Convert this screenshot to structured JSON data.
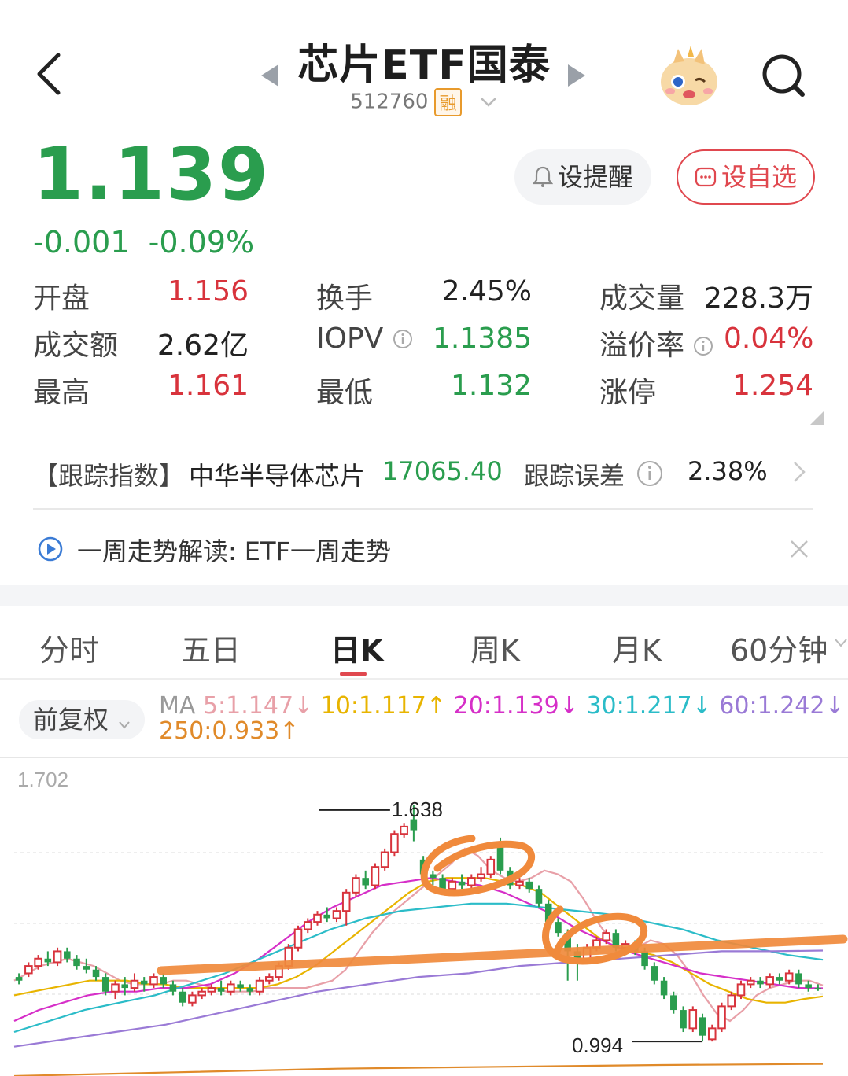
{
  "header": {
    "title": "芯片ETF国泰",
    "code": "512760",
    "badge": "融",
    "icons": {
      "back": "back-arrow-icon",
      "prev": "prev-triangle-icon",
      "next": "next-triangle-icon",
      "dropdown": "chevron-down-icon",
      "mascot": "mascot-avatar",
      "search": "search-icon"
    }
  },
  "quote": {
    "price": "1.139",
    "change": "-0.001",
    "change_pct": "-0.09%",
    "color_down": "#2a9d4e",
    "color_up": "#d8333c"
  },
  "actions": {
    "alert_label": "设提醒",
    "fav_label": "设自选"
  },
  "stats": {
    "open_label": "开盘",
    "open": "1.156",
    "turnover_label": "换手",
    "turnover": "2.45%",
    "volume_label": "成交量",
    "volume": "228.3万",
    "amount_label": "成交额",
    "amount": "2.62亿",
    "iopv_label": "IOPV",
    "iopv": "1.1385",
    "premium_label": "溢价率",
    "premium": "0.04%",
    "high_label": "最高",
    "high": "1.161",
    "low_label": "最低",
    "low": "1.132",
    "limit_label": "涨停",
    "limit": "1.254"
  },
  "tracking": {
    "tag": "【跟踪指数】",
    "index_name": "中华半导体芯片",
    "index_value": "17065.40",
    "error_label": "跟踪误差",
    "error_value": "2.38%"
  },
  "weekly": {
    "label": "一周走势解读:",
    "text": "ETF一周走势"
  },
  "tabs": [
    "分时",
    "五日",
    "日K",
    "周K",
    "月K",
    "60分钟"
  ],
  "chart_controls": {
    "adjust": "前复权",
    "ma_prefix": "MA",
    "ma5": "5:1.147↓",
    "ma10": "10:1.117↑",
    "ma20": "20:1.139↓",
    "ma30": "30:1.217↓",
    "ma60": "60:1.242↓",
    "ma250": "250:0.933↑",
    "colors": {
      "ma5": "#e8a0a8",
      "ma10": "#e8b400",
      "ma20": "#d62fc8",
      "ma30": "#2bbcc8",
      "ma60": "#9a7ad6",
      "ma250": "#e08a2a"
    }
  },
  "chart_data": {
    "type": "candlestick",
    "y_top_label": "1.702",
    "ylim": [
      0.93,
      1.702
    ],
    "annotations": {
      "high": "1.638",
      "low": "0.994"
    },
    "candles": [
      [
        1.17,
        1.16,
        1.18,
        1.15
      ],
      [
        1.18,
        1.2,
        1.21,
        1.17
      ],
      [
        1.2,
        1.22,
        1.23,
        1.19
      ],
      [
        1.22,
        1.21,
        1.24,
        1.2
      ],
      [
        1.21,
        1.24,
        1.25,
        1.2
      ],
      [
        1.24,
        1.22,
        1.25,
        1.21
      ],
      [
        1.22,
        1.2,
        1.23,
        1.19
      ],
      [
        1.2,
        1.19,
        1.22,
        1.18
      ],
      [
        1.19,
        1.17,
        1.2,
        1.16
      ],
      [
        1.17,
        1.13,
        1.18,
        1.12
      ],
      [
        1.13,
        1.15,
        1.16,
        1.11
      ],
      [
        1.15,
        1.14,
        1.17,
        1.12
      ],
      [
        1.14,
        1.16,
        1.18,
        1.13
      ],
      [
        1.16,
        1.15,
        1.17,
        1.13
      ],
      [
        1.15,
        1.17,
        1.18,
        1.14
      ],
      [
        1.17,
        1.15,
        1.18,
        1.14
      ],
      [
        1.15,
        1.13,
        1.16,
        1.12
      ],
      [
        1.13,
        1.1,
        1.14,
        1.09
      ],
      [
        1.1,
        1.12,
        1.13,
        1.09
      ],
      [
        1.12,
        1.13,
        1.14,
        1.11
      ],
      [
        1.13,
        1.14,
        1.15,
        1.12
      ],
      [
        1.14,
        1.13,
        1.16,
        1.12
      ],
      [
        1.13,
        1.15,
        1.16,
        1.12
      ],
      [
        1.15,
        1.14,
        1.16,
        1.13
      ],
      [
        1.14,
        1.13,
        1.15,
        1.12
      ],
      [
        1.13,
        1.16,
        1.17,
        1.12
      ],
      [
        1.16,
        1.17,
        1.18,
        1.15
      ],
      [
        1.17,
        1.2,
        1.21,
        1.16
      ],
      [
        1.2,
        1.25,
        1.26,
        1.19
      ],
      [
        1.25,
        1.3,
        1.31,
        1.24
      ],
      [
        1.3,
        1.32,
        1.33,
        1.29
      ],
      [
        1.32,
        1.34,
        1.35,
        1.31
      ],
      [
        1.34,
        1.33,
        1.36,
        1.32
      ],
      [
        1.33,
        1.35,
        1.36,
        1.32
      ],
      [
        1.35,
        1.4,
        1.41,
        1.31
      ],
      [
        1.4,
        1.44,
        1.45,
        1.39
      ],
      [
        1.44,
        1.42,
        1.46,
        1.41
      ],
      [
        1.42,
        1.47,
        1.48,
        1.41
      ],
      [
        1.47,
        1.51,
        1.52,
        1.46
      ],
      [
        1.51,
        1.56,
        1.57,
        1.5
      ],
      [
        1.56,
        1.58,
        1.59,
        1.55
      ],
      [
        1.6,
        1.57,
        1.638,
        1.54
      ],
      [
        1.49,
        1.45,
        1.5,
        1.44
      ],
      [
        1.45,
        1.44,
        1.46,
        1.42
      ],
      [
        1.44,
        1.41,
        1.45,
        1.4
      ],
      [
        1.41,
        1.43,
        1.44,
        1.4
      ],
      [
        1.43,
        1.42,
        1.45,
        1.41
      ],
      [
        1.42,
        1.44,
        1.45,
        1.41
      ],
      [
        1.44,
        1.45,
        1.47,
        1.43
      ],
      [
        1.45,
        1.49,
        1.5,
        1.44
      ],
      [
        1.54,
        1.46,
        1.55,
        1.45
      ],
      [
        1.46,
        1.42,
        1.47,
        1.41
      ],
      [
        1.42,
        1.43,
        1.44,
        1.41
      ],
      [
        1.43,
        1.41,
        1.44,
        1.4
      ],
      [
        1.41,
        1.37,
        1.42,
        1.36
      ],
      [
        1.37,
        1.32,
        1.38,
        1.31
      ],
      [
        1.32,
        1.29,
        1.33,
        1.28
      ],
      [
        1.29,
        1.24,
        1.3,
        1.16
      ],
      [
        1.24,
        1.22,
        1.26,
        1.16
      ],
      [
        1.22,
        1.25,
        1.26,
        1.21
      ],
      [
        1.25,
        1.27,
        1.28,
        1.24
      ],
      [
        1.27,
        1.29,
        1.3,
        1.26
      ],
      [
        1.29,
        1.25,
        1.3,
        1.24
      ],
      [
        1.25,
        1.26,
        1.27,
        1.24
      ],
      [
        1.26,
        1.24,
        1.27,
        1.23
      ],
      [
        1.24,
        1.2,
        1.25,
        1.19
      ],
      [
        1.2,
        1.16,
        1.21,
        1.15
      ],
      [
        1.16,
        1.12,
        1.17,
        1.11
      ],
      [
        1.12,
        1.08,
        1.13,
        1.07
      ],
      [
        1.08,
        1.03,
        1.09,
        1.02
      ],
      [
        1.03,
        1.08,
        1.09,
        1.02
      ],
      [
        1.06,
        1.01,
        1.07,
        0.994
      ],
      [
        1.0,
        1.03,
        1.04,
        0.994
      ],
      [
        1.03,
        1.09,
        1.1,
        1.02
      ],
      [
        1.09,
        1.12,
        1.13,
        1.08
      ],
      [
        1.12,
        1.15,
        1.16,
        1.11
      ],
      [
        1.15,
        1.16,
        1.17,
        1.14
      ],
      [
        1.16,
        1.15,
        1.17,
        1.14
      ],
      [
        1.15,
        1.17,
        1.18,
        1.14
      ],
      [
        1.17,
        1.16,
        1.18,
        1.15
      ],
      [
        1.16,
        1.18,
        1.19,
        1.15
      ],
      [
        1.18,
        1.15,
        1.19,
        1.14
      ],
      [
        1.15,
        1.14,
        1.16,
        1.13
      ],
      [
        1.14,
        1.139,
        1.15,
        1.132
      ]
    ],
    "series": [
      {
        "values": [
          1.16,
          1.18,
          1.2,
          1.21,
          1.22,
          1.21,
          1.2,
          1.18,
          1.16,
          1.15,
          1.15,
          1.15,
          1.16,
          1.16,
          1.15,
          1.14,
          1.13,
          1.13,
          1.13,
          1.14,
          1.14,
          1.14,
          1.14,
          1.15,
          1.16,
          1.19,
          1.24,
          1.29,
          1.33,
          1.36,
          1.39,
          1.42,
          1.45,
          1.48,
          1.52,
          1.5,
          1.46,
          1.44,
          1.43,
          1.44,
          1.46,
          1.45,
          1.43,
          1.38,
          1.32,
          1.27,
          1.24,
          1.25,
          1.27,
          1.26,
          1.23,
          1.18,
          1.12,
          1.07,
          1.05,
          1.08,
          1.12,
          1.14,
          1.15,
          1.16,
          1.16,
          1.147
        ]
      },
      {
        "values": [
          1.12,
          1.13,
          1.14,
          1.15,
          1.16,
          1.16,
          1.16,
          1.15,
          1.15,
          1.14,
          1.14,
          1.14,
          1.14,
          1.14,
          1.15,
          1.17,
          1.2,
          1.24,
          1.28,
          1.32,
          1.36,
          1.4,
          1.43,
          1.44,
          1.44,
          1.44,
          1.43,
          1.42,
          1.4,
          1.36,
          1.32,
          1.28,
          1.25,
          1.24,
          1.23,
          1.21,
          1.18,
          1.15,
          1.13,
          1.11,
          1.1,
          1.1,
          1.11,
          1.117
        ]
      },
      {
        "values": [
          1.05,
          1.08,
          1.1,
          1.12,
          1.13,
          1.13,
          1.14,
          1.14,
          1.15,
          1.18,
          1.22,
          1.27,
          1.32,
          1.36,
          1.39,
          1.42,
          1.43,
          1.44,
          1.43,
          1.42,
          1.4,
          1.37,
          1.34,
          1.3,
          1.27,
          1.24,
          1.22,
          1.2,
          1.18,
          1.17,
          1.16,
          1.15,
          1.14,
          1.139
        ]
      },
      {
        "values": [
          1.02,
          1.05,
          1.08,
          1.1,
          1.12,
          1.15,
          1.18,
          1.22,
          1.26,
          1.3,
          1.33,
          1.35,
          1.36,
          1.37,
          1.37,
          1.36,
          1.35,
          1.34,
          1.32,
          1.3,
          1.27,
          1.25,
          1.23,
          1.217
        ]
      },
      {
        "values": [
          0.98,
          1.0,
          1.02,
          1.04,
          1.07,
          1.1,
          1.13,
          1.15,
          1.17,
          1.18,
          1.2,
          1.21,
          1.22,
          1.23,
          1.24,
          1.24,
          1.242
        ]
      },
      {
        "values": [
          0.9,
          0.91,
          0.92,
          0.925,
          0.93,
          0.933
        ]
      }
    ]
  }
}
